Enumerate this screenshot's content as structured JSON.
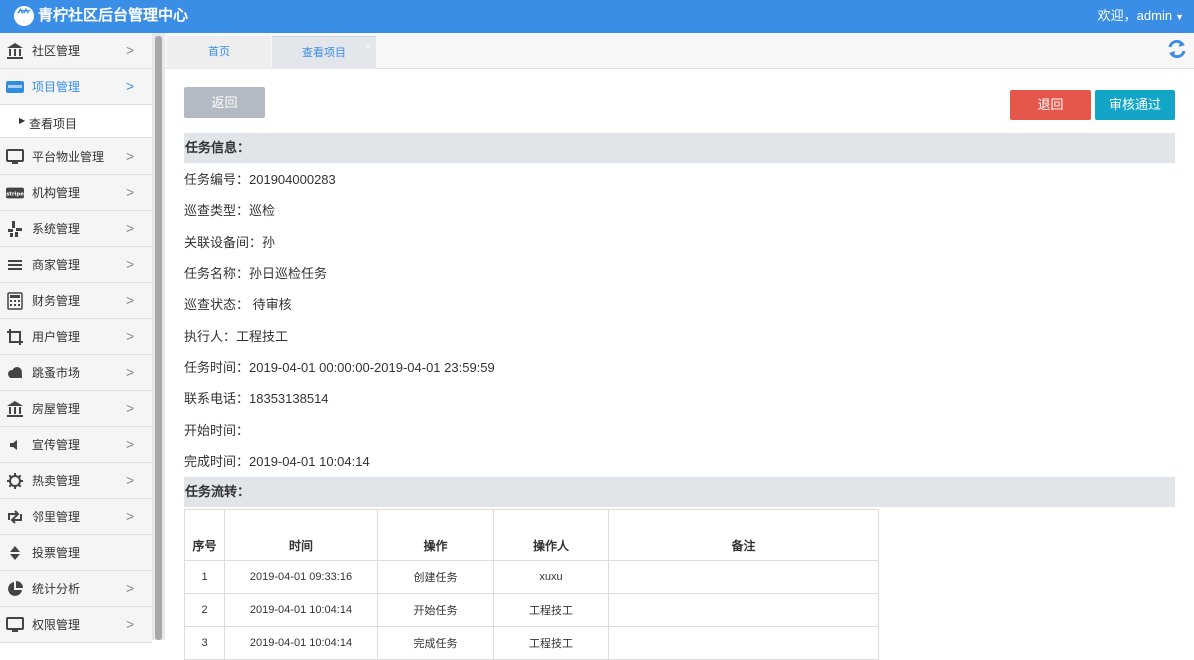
{
  "app": {
    "logo_glyph": "⺮",
    "title": "青柠社区后台管理中心",
    "welcome": "欢迎，admin",
    "caret": "▼"
  },
  "sidebar": {
    "items": [
      {
        "label": "社区管理",
        "icon": "bank-icon"
      },
      {
        "label": "项目管理",
        "icon": "card-icon",
        "active": true
      },
      {
        "label": "平台物业管理",
        "icon": "monitor-icon"
      },
      {
        "label": "机构管理",
        "icon": "stripe-icon"
      },
      {
        "label": "系统管理",
        "icon": "yelp-icon"
      },
      {
        "label": "商家管理",
        "icon": "bars-icon"
      },
      {
        "label": "财务管理",
        "icon": "calculator-icon"
      },
      {
        "label": "用户管理",
        "icon": "crop-icon"
      },
      {
        "label": "跳蚤市场",
        "icon": "cloud-icon"
      },
      {
        "label": "房屋管理",
        "icon": "bank-icon"
      },
      {
        "label": "宣传管理",
        "icon": "volume-icon"
      },
      {
        "label": "热卖管理",
        "icon": "gear-icon"
      },
      {
        "label": "邻里管理",
        "icon": "retweet-icon"
      },
      {
        "label": "投票管理",
        "icon": "sort-icon"
      },
      {
        "label": "统计分析",
        "icon": "pie-chart-icon"
      },
      {
        "label": "权限管理",
        "icon": "monitor-icon"
      }
    ],
    "sub_item": "查看项目",
    "arrow": ">",
    "sub_tri": "▶"
  },
  "tabs": {
    "home": "首页",
    "view": "查看项目",
    "close": "×"
  },
  "toolbar": {
    "back": "返回",
    "reject": "退回",
    "approve": "审核通过"
  },
  "task_info": {
    "heading": "任务信息：",
    "fields": [
      "任务编号：201904000283",
      "巡查类型：巡检",
      "关联设备间：孙",
      "任务名称：孙日巡检任务",
      "巡查状态： 待审核",
      "执行人：工程技工",
      "任务时间：2019-04-01 00:00:00-2019-04-01 23:59:59",
      "联系电话：18353138514",
      "开始时间：",
      "完成时间：2019-04-01 10:04:14"
    ]
  },
  "task_flow": {
    "heading": "任务流转：",
    "columns": [
      "序号",
      "时间",
      "操作",
      "操作人",
      "备注"
    ],
    "rows": [
      [
        "1",
        "2019-04-01 09:33:16",
        "创建任务",
        "xuxu",
        ""
      ],
      [
        "2",
        "2019-04-01 10:04:14",
        "开始任务",
        "工程技工",
        ""
      ],
      [
        "3",
        "2019-04-01 10:04:14",
        "完成任务",
        "工程技工",
        ""
      ]
    ]
  },
  "colors": {
    "primary": "#3a8ee6",
    "danger": "#e5574b",
    "info": "#12a5c8",
    "muted": "#b3bac3"
  }
}
